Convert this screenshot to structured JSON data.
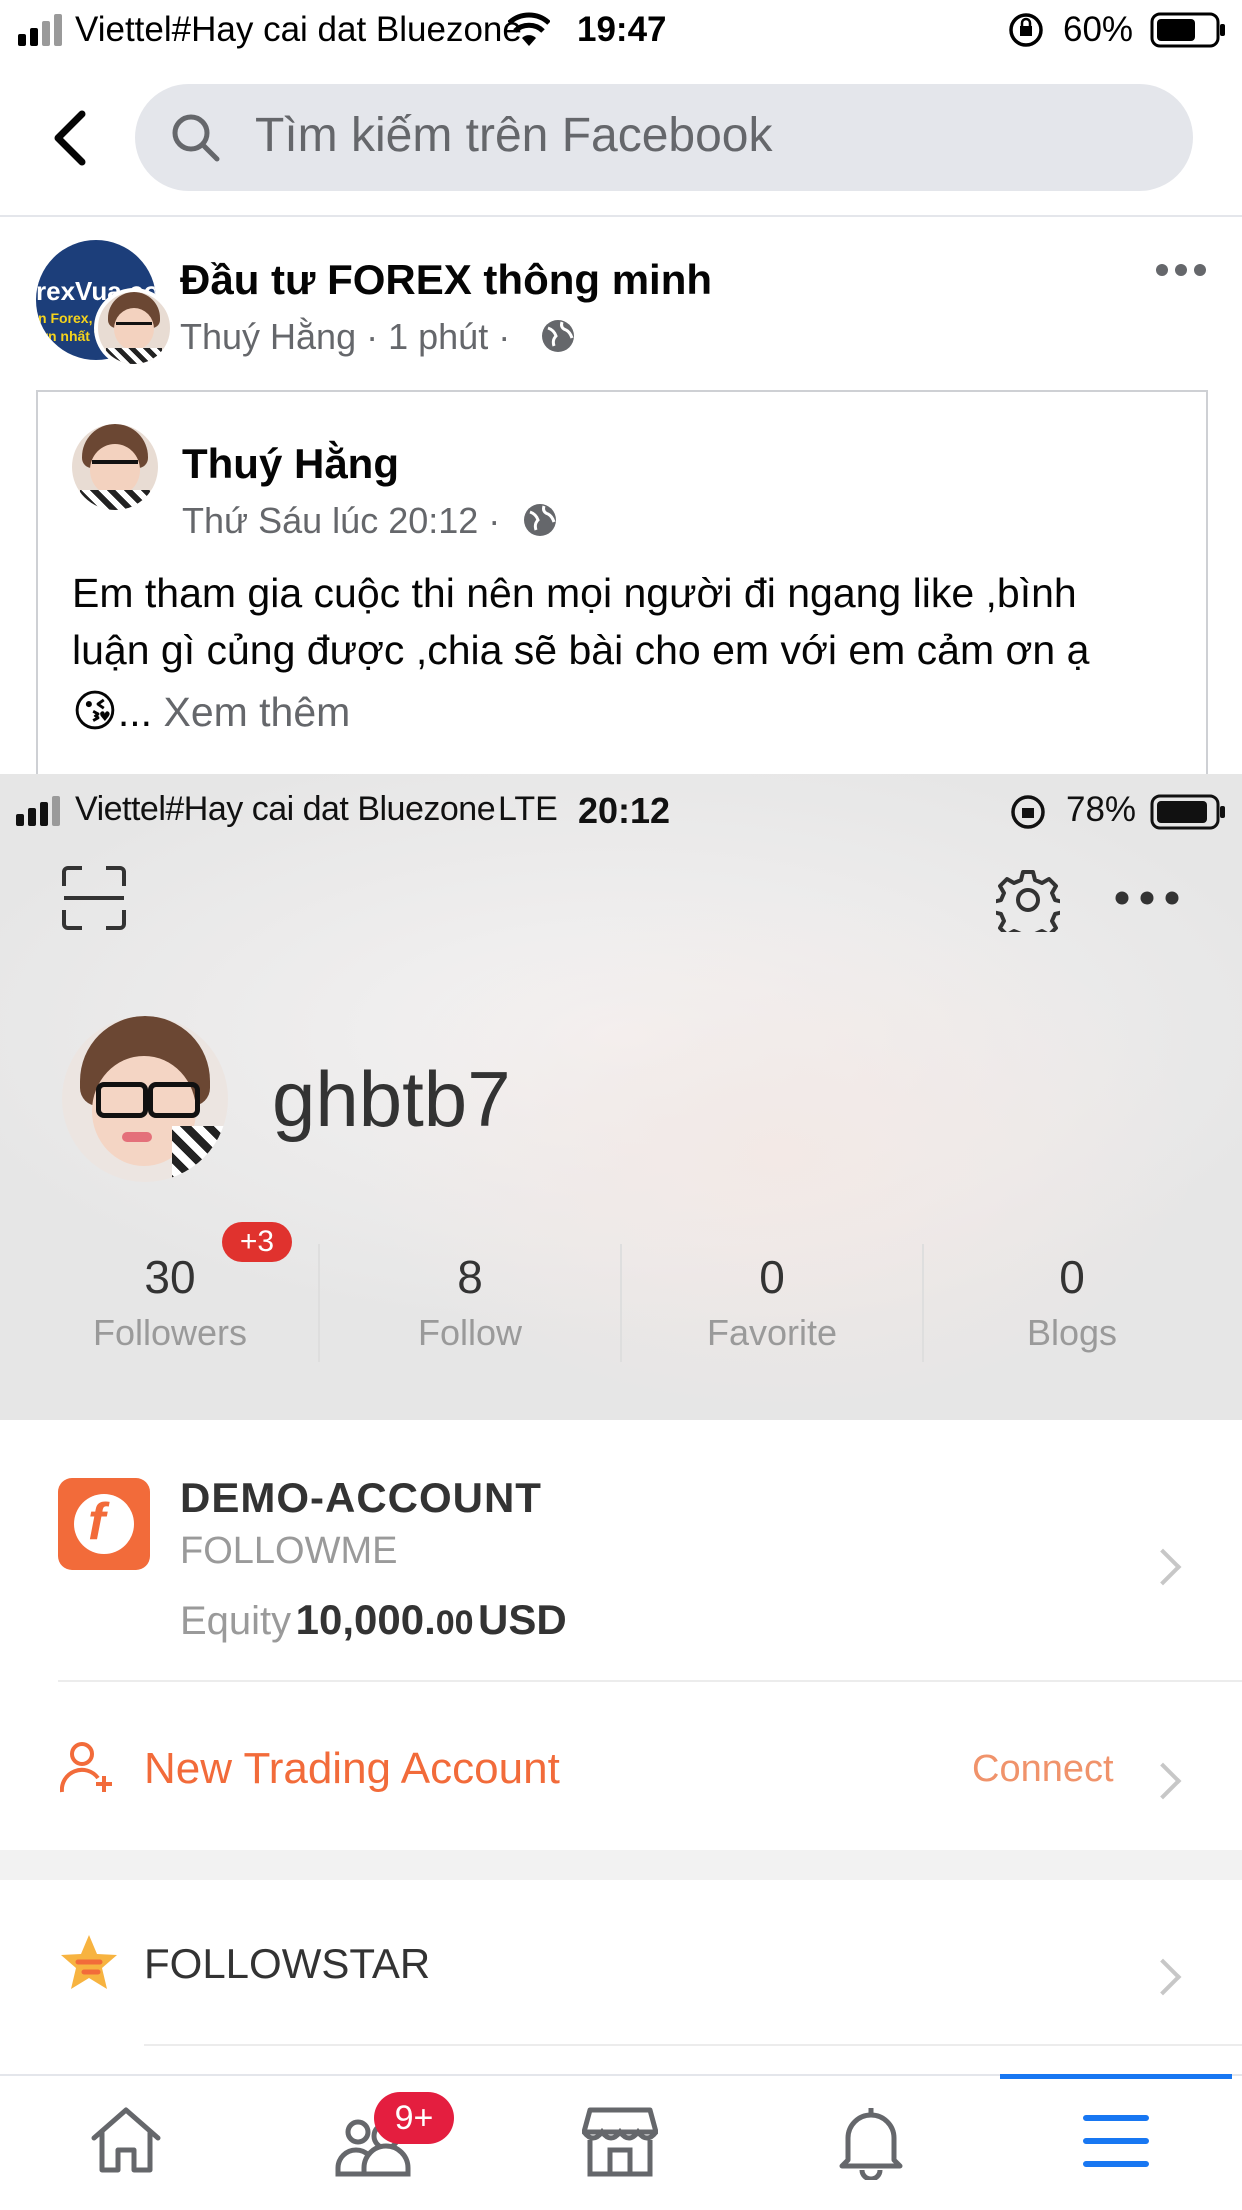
{
  "status_bar": {
    "carrier": "Viettel#Hay cai dat Bluezone",
    "time": "19:47",
    "battery": "60%"
  },
  "header": {
    "search_placeholder": "Tìm kiếm trên Facebook"
  },
  "post": {
    "group_name": "Đầu tư FOREX thông minh",
    "group_avatar_text": "rexVua.co",
    "group_avatar_subtext_1": "n Forex, về",
    "group_avatar_subtext_2": "ớn nhất V",
    "author": "Thuý Hằng",
    "time": "1 phút",
    "shared": {
      "author": "Thuý Hằng",
      "time": "Thứ Sáu lúc 20:12",
      "text_line1": "Em tham gia cuộc thi nên mọi người đi ngang like ,bình",
      "text_line2": "luận gì củng được ,chia sẽ bài cho em với em cảm ơn ạ",
      "emoji": "😘",
      "ellipsis": "...",
      "see_more": "Xem thêm"
    }
  },
  "screenshot": {
    "status_carrier": "Viettel#Hay cai dat Bluezone",
    "status_network": "LTE",
    "status_time": "20:12",
    "status_battery": "78%",
    "username": "ghbtb7",
    "stats": [
      {
        "value": "30",
        "label": "Followers",
        "badge": "+3"
      },
      {
        "value": "8",
        "label": "Follow"
      },
      {
        "value": "0",
        "label": "Favorite"
      },
      {
        "value": "0",
        "label": "Blogs"
      }
    ],
    "account": {
      "title": "DEMO-ACCOUNT",
      "subtitle": "FOLLOWME",
      "equity_label": "Equity",
      "equity_int": "10,000.",
      "equity_dec": "00",
      "equity_currency": "USD"
    },
    "new_account": {
      "label": "New Trading Account",
      "action": "Connect"
    },
    "followstar": {
      "label": "FOLLOWSTAR"
    },
    "colors": {
      "accent_orange": "#f26b3a",
      "badge_red": "#e0322e"
    }
  },
  "bottom_nav": {
    "items": [
      "home-icon",
      "friends-icon",
      "marketplace-icon",
      "notifications-icon",
      "menu-icon"
    ],
    "friends_badge": "9+",
    "active_color": "#1877f2"
  }
}
